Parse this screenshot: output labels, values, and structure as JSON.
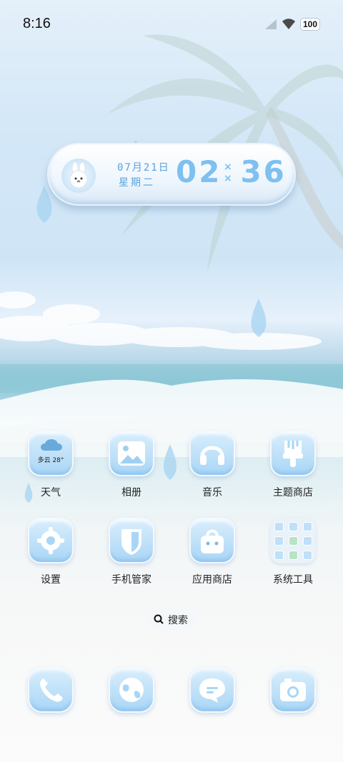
{
  "status_bar": {
    "time": "8:16",
    "battery": "100"
  },
  "widget": {
    "date": "07月21日",
    "weekday": "星期二",
    "hour": "02",
    "minute": "36"
  },
  "apps_row1": [
    {
      "label": "天气",
      "icon": "weather-icon",
      "weather_text": "多云 28°"
    },
    {
      "label": "相册",
      "icon": "gallery-icon"
    },
    {
      "label": "音乐",
      "icon": "headphones-icon"
    },
    {
      "label": "主题商店",
      "icon": "paint-brush-icon"
    }
  ],
  "apps_row2": [
    {
      "label": "设置",
      "icon": "gear-icon"
    },
    {
      "label": "手机管家",
      "icon": "shield-icon"
    },
    {
      "label": "应用商店",
      "icon": "shopping-bag-icon"
    },
    {
      "label": "系统工具",
      "icon": "folder-icon"
    }
  ],
  "search": {
    "label": "搜索"
  },
  "dock": [
    {
      "icon": "phone-icon"
    },
    {
      "icon": "browser-icon"
    },
    {
      "icon": "messages-icon"
    },
    {
      "icon": "camera-icon"
    }
  ],
  "colors": {
    "accent": "#7ec0ef",
    "icon_top": "#d9eefc",
    "icon_bottom": "#a9d6f6"
  }
}
